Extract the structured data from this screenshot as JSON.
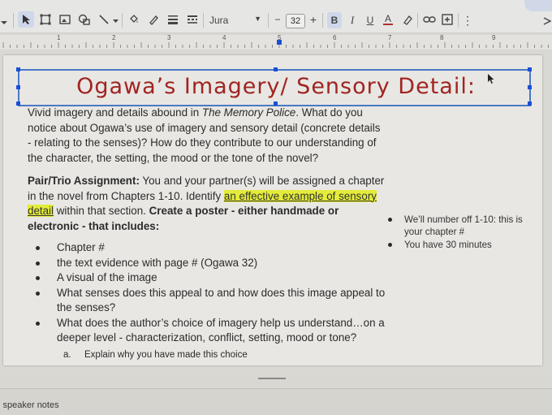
{
  "toolbar": {
    "font_name": "Jura",
    "font_size": "32",
    "minus": "−",
    "plus": "+",
    "bold": "B",
    "italic": "I",
    "underline": "U",
    "text_color": "A",
    "more": "⋮"
  },
  "ruler": {
    "numbers": [
      "1",
      "2",
      "3",
      "4",
      "5",
      "6",
      "7",
      "8",
      "9"
    ]
  },
  "slide": {
    "title": "Ogawa’s Imagery/ Sensory Detail:",
    "intro": {
      "before": "Vivid imagery and details abound in ",
      "book": "The Memory Police",
      "after": ".  What do you notice about Ogawa’s use of imagery and sensory detail (concrete details - relating to the senses)?  How do they contribute to our understanding of the character, the setting, the mood or the tone of the novel?"
    },
    "assignment": {
      "label": "Pair/Trio Assignment:",
      "text1": " You and your partner(s) will be assigned a chapter in the novel from Chapters 1-10. Identify ",
      "highlight": "an effective example of sensory detail",
      "text2": " within that section. ",
      "bold_end": "Create a poster - either handmade or electronic - that includes:"
    },
    "bullets": [
      "Chapter #",
      "the text evidence with page # (Ogawa 32)",
      "A visual of the image",
      "What senses does this appeal to and how does this image appeal to the senses?",
      "What does the author’s choice of imagery help us understand…on a deeper level - characterization, conflict, setting, mood or tone?"
    ],
    "sub_bullet": {
      "letter": "a.",
      "text": "Explain why you have made this choice"
    },
    "side_notes": [
      "We’ll number off 1-10: this is your chapter #",
      "You have 30 minutes"
    ]
  },
  "footer": {
    "speaker_notes": "l speaker notes"
  },
  "colors": {
    "title": "#a02422",
    "selection": "#4a78c8",
    "highlight": "#e4ec3a"
  }
}
